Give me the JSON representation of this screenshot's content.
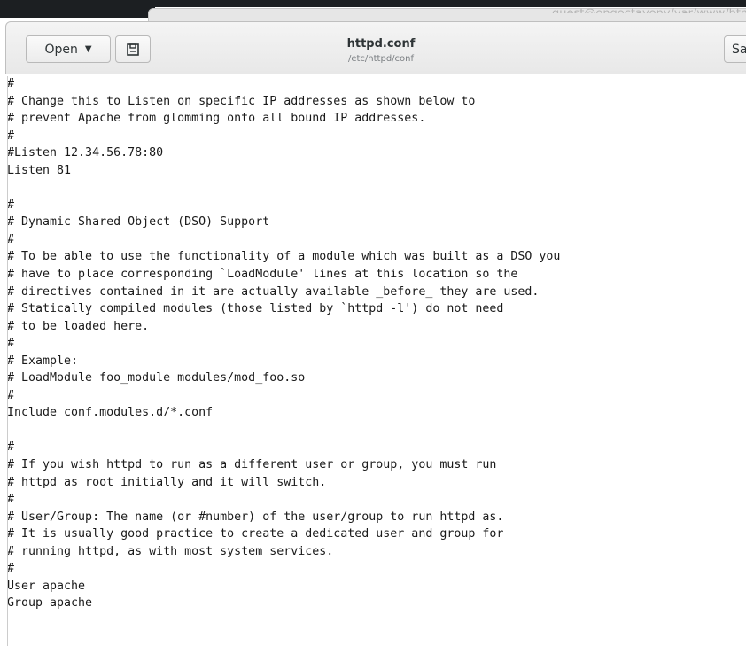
{
  "window": {
    "behind_title": "guest@ongoctayony/var/www/html",
    "title": "httpd.conf",
    "subtitle": "/etc/httpd/conf"
  },
  "toolbar": {
    "open_label": "Open",
    "open_arrow_icon": "chevron-down-icon",
    "save_doc_icon": "document-save-icon",
    "save_label": "Sav"
  },
  "editor": {
    "lines": [
      "#",
      "# Change this to Listen on specific IP addresses as shown below to",
      "# prevent Apache from glomming onto all bound IP addresses.",
      "#",
      "#Listen 12.34.56.78:80",
      "Listen 81",
      "",
      "#",
      "# Dynamic Shared Object (DSO) Support",
      "#",
      "# To be able to use the functionality of a module which was built as a DSO you",
      "# have to place corresponding `LoadModule' lines at this location so the",
      "# directives contained in it are actually available _before_ they are used.",
      "# Statically compiled modules (those listed by `httpd -l') do not need",
      "# to be loaded here.",
      "#",
      "# Example:",
      "# LoadModule foo_module modules/mod_foo.so",
      "#",
      "Include conf.modules.d/*.conf",
      "",
      "#",
      "# If you wish httpd to run as a different user or group, you must run",
      "# httpd as root initially and it will switch.",
      "#",
      "# User/Group: The name (or #number) of the user/group to run httpd as.",
      "# It is usually good practice to create a dedicated user and group for",
      "# running httpd, as with most system services.",
      "#",
      "User apache",
      "Group apache"
    ]
  }
}
